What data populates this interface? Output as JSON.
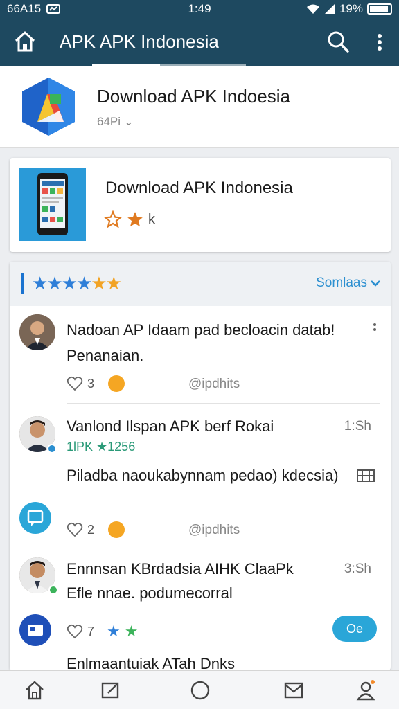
{
  "status_bar": {
    "carrier": "66A15",
    "time": "1:49",
    "battery": "19%"
  },
  "app_bar": {
    "title": "APK APK Indonesia"
  },
  "header": {
    "app_name": "Download APK Indoesia",
    "sub": "64Pi ⌄"
  },
  "promo": {
    "title": "Download APK Indonesia",
    "rating_suffix": "k"
  },
  "reviews": {
    "sort_label": "Somlaas",
    "items": [
      {
        "name": "Nadoan AP Idaam pad becloacin datab!",
        "text": "Penanaian.",
        "likes": "3",
        "replies": "@ipdhits"
      },
      {
        "name": "Vanlond Ilspan APK berf Rokai",
        "time": "1:Sh",
        "meta": "1lPK ★1256",
        "text": "Piladba naoukabynnam pedao) kdecsia)",
        "likes": "2",
        "replies": "@ipdhits"
      },
      {
        "name": "Ennnsan KBrdadsia AIHK ClaaPk",
        "time": "3:Sh",
        "text": "Efle nnae. podumecorral",
        "likes": "7",
        "pill": "Oe"
      },
      {
        "name": "Enlmaantuiak ATah Dnks"
      }
    ]
  },
  "colors": {
    "primary": "#1e4960",
    "accent": "#2b8fd0",
    "star_orange": "#f2a324",
    "star_blue": "#2f7fd8"
  }
}
